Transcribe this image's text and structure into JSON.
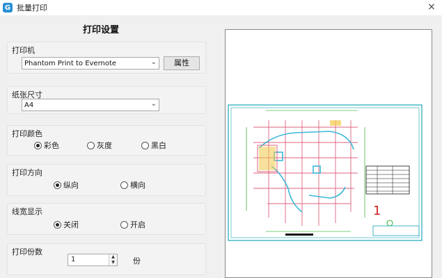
{
  "window": {
    "title": "批量打印",
    "close": "×"
  },
  "heading": "打印设置",
  "printer": {
    "label": "打印机",
    "value": "Phantom Print to Evernote",
    "properties_label": "属性"
  },
  "paper": {
    "label": "纸张尺寸",
    "value": "A4"
  },
  "color": {
    "label": "打印颜色",
    "options": [
      "彩色",
      "灰度",
      "黑白"
    ],
    "selected": "彩色"
  },
  "orientation": {
    "label": "打印方向",
    "options": [
      "纵向",
      "横向"
    ],
    "selected": "纵向"
  },
  "lineweight": {
    "label": "线宽显示",
    "options": [
      "关闭",
      "开启"
    ],
    "selected": "关闭"
  },
  "copies": {
    "label": "打印份数",
    "value": "1",
    "unit": "份"
  },
  "preview": {
    "sheet_number": "1"
  },
  "colors": {
    "drawing_border": "#1aa6b7",
    "grid": "#e0607e",
    "walls": "#38b8d8",
    "dimension": "#00a000",
    "highlight": "#f2c94c"
  }
}
